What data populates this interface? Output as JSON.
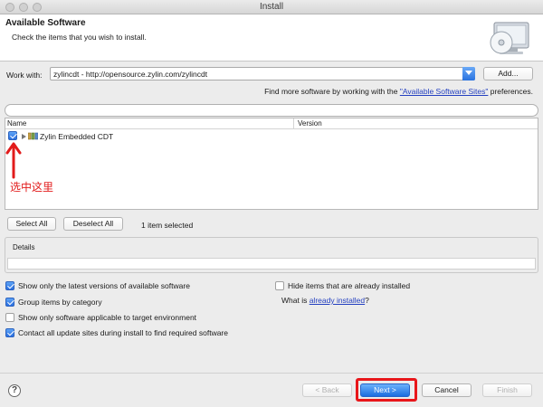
{
  "window": {
    "title": "Install"
  },
  "header": {
    "title": "Available Software",
    "subtitle": "Check the items that you wish to install.",
    "icon": "install-wizard-icon"
  },
  "work_with": {
    "label": "Work with:",
    "value": "zylincdt - http://opensource.zylin.com/zylincdt",
    "add_label": "Add..."
  },
  "find_more": {
    "prefix": "Find more software by working with the ",
    "link": "\"Available Software Sites\"",
    "suffix": " preferences."
  },
  "filter": {
    "value": ""
  },
  "tree": {
    "columns": [
      "Name",
      "Version"
    ],
    "rows": [
      {
        "label": "Zylin Embedded CDT",
        "version": "",
        "checked": true
      }
    ]
  },
  "annotation": {
    "note": "选中这里",
    "color": "#e21b1b"
  },
  "selection": {
    "select_all": "Select All",
    "deselect_all": "Deselect All",
    "status": "1 item selected"
  },
  "details": {
    "label": "Details",
    "value": ""
  },
  "options": {
    "latest_only": {
      "label": "Show only the latest versions of available software",
      "checked": true
    },
    "group_by_category": {
      "label": "Group items by category",
      "checked": true
    },
    "target_env": {
      "label": "Show only software applicable to target environment",
      "checked": false
    },
    "contact_sites": {
      "label": "Contact all update sites during install to find required software",
      "checked": true
    },
    "hide_installed": {
      "label": "Hide items that are already installed",
      "checked": false
    },
    "what_is_prefix": "What is ",
    "what_is_link": "already installed",
    "what_is_suffix": "?"
  },
  "footer": {
    "help": "?",
    "back": "< Back",
    "next": "Next >",
    "cancel": "Cancel",
    "finish": "Finish",
    "highlight_color": "#e8161a"
  }
}
